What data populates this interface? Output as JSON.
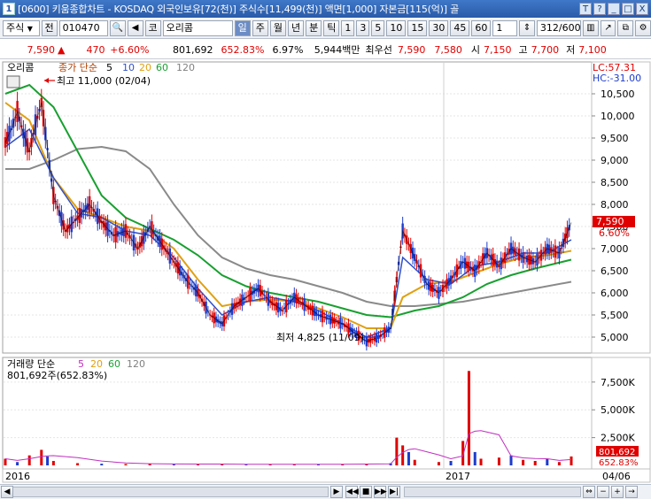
{
  "window": {
    "icon_label": "1",
    "title": "[0600] 키움종합차트 - KOSDAQ 외국인보유[72(천)] 주식수[11,499(천)] 액면[1,000] 자본금[115(억)] 골",
    "buttons": [
      "T",
      "?",
      "_",
      "□",
      "X"
    ]
  },
  "toolbar": {
    "market": "주식",
    "jeon_label": "전",
    "code": "010470",
    "name": "오리콤",
    "name_prefix": "코",
    "periods": [
      "일",
      "주",
      "월",
      "년",
      "분",
      "틱"
    ],
    "active_period": "일",
    "intervals": [
      "1",
      "3",
      "5",
      "10",
      "15",
      "30",
      "45",
      "60"
    ],
    "unit": "1",
    "page": "312/600"
  },
  "quote": {
    "price": "7,590",
    "change": "470",
    "change_pct": "+6.60%",
    "volume": "801,692",
    "volume_pct": "652.83%",
    "turnover": "6.97%",
    "amount": "5,944백만",
    "best_label": "최우선",
    "ask": "7,590",
    "bid": "7,580",
    "open_label": "시",
    "open": "7,150",
    "high_label": "고",
    "high": "7,700",
    "low_label": "저",
    "low": "7,100"
  },
  "price_panel": {
    "stock_name": "오리콤",
    "legend_prefix": "종가 단순",
    "legend": [
      {
        "label": "5",
        "color": "#000000"
      },
      {
        "label": "10",
        "color": "#3050c8"
      },
      {
        "label": "20",
        "color": "#e0a010"
      },
      {
        "label": "60",
        "color": "#18a030"
      },
      {
        "label": "120",
        "color": "#808080"
      }
    ],
    "lc": "LC:57.31",
    "hc": "HC:-31.00",
    "high_annotation": "최고 11,000 (02/04)",
    "low_annotation": "최저 4,825 (11/09)",
    "last_price_tag": "7,590",
    "last_pct_tag": "6.60%"
  },
  "volume_panel": {
    "legend_prefix": "거래량 단순",
    "legend": [
      {
        "label": "5",
        "color": "#c030c0"
      },
      {
        "label": "20",
        "color": "#e0a010"
      },
      {
        "label": "60",
        "color": "#18a030"
      },
      {
        "label": "120",
        "color": "#808080"
      }
    ],
    "value_label": "801,692주(652.83%)",
    "last_volume_tag": "801,692",
    "last_pct_tag": "652.83%"
  },
  "x_axis": {
    "labels": [
      "2016",
      "2017"
    ],
    "right_label": "04/06"
  },
  "chart_data": [
    {
      "type": "line",
      "title": "오리콤",
      "series": [
        {
          "name": "5",
          "color": "#000000"
        },
        {
          "name": "10",
          "color": "#3050c8"
        },
        {
          "name": "20",
          "color": "#e0a010"
        },
        {
          "name": "60",
          "color": "#18a030"
        },
        {
          "name": "120",
          "color": "#808080"
        }
      ],
      "y_ticks": [
        "10,500",
        "10,000",
        "9,500",
        "9,000",
        "8,500",
        "8,000",
        "7,500",
        "7,000",
        "6,500",
        "6,000",
        "5,500",
        "5,000"
      ],
      "ylim": [
        4700,
        11100
      ],
      "close_points": [
        [
          0,
          9400
        ],
        [
          1,
          9700
        ],
        [
          2,
          10100
        ],
        [
          3,
          9600
        ],
        [
          4,
          9200
        ],
        [
          5,
          9800
        ],
        [
          6,
          10300
        ],
        [
          8,
          8200
        ],
        [
          10,
          7400
        ],
        [
          12,
          7700
        ],
        [
          14,
          8000
        ],
        [
          16,
          7600
        ],
        [
          18,
          7300
        ],
        [
          20,
          7400
        ],
        [
          22,
          7000
        ],
        [
          24,
          7500
        ],
        [
          26,
          7100
        ],
        [
          28,
          6700
        ],
        [
          30,
          6300
        ],
        [
          32,
          6000
        ],
        [
          34,
          5500
        ],
        [
          36,
          5300
        ],
        [
          38,
          5700
        ],
        [
          40,
          5900
        ],
        [
          42,
          6100
        ],
        [
          44,
          5800
        ],
        [
          46,
          5600
        ],
        [
          48,
          5900
        ],
        [
          50,
          5700
        ],
        [
          52,
          5500
        ],
        [
          54,
          5400
        ],
        [
          56,
          5300
        ],
        [
          58,
          5100
        ],
        [
          60,
          4900
        ],
        [
          62,
          5000
        ],
        [
          64,
          5200
        ],
        [
          66,
          7400
        ],
        [
          68,
          6800
        ],
        [
          70,
          6200
        ],
        [
          72,
          6000
        ],
        [
          74,
          6300
        ],
        [
          76,
          6700
        ],
        [
          78,
          6500
        ],
        [
          80,
          6900
        ],
        [
          82,
          6600
        ],
        [
          84,
          7000
        ],
        [
          86,
          6800
        ],
        [
          88,
          6700
        ],
        [
          90,
          7000
        ],
        [
          92,
          6900
        ],
        [
          94,
          7590
        ]
      ],
      "ma5": [
        [
          0,
          9300
        ],
        [
          4,
          9700
        ],
        [
          8,
          8600
        ],
        [
          12,
          7800
        ],
        [
          16,
          7700
        ],
        [
          20,
          7400
        ],
        [
          24,
          7300
        ],
        [
          28,
          6800
        ],
        [
          32,
          6100
        ],
        [
          36,
          5500
        ],
        [
          40,
          5800
        ],
        [
          44,
          5900
        ],
        [
          48,
          5800
        ],
        [
          52,
          5600
        ],
        [
          56,
          5300
        ],
        [
          60,
          5000
        ],
        [
          64,
          5200
        ],
        [
          66,
          6800
        ],
        [
          70,
          6300
        ],
        [
          74,
          6200
        ],
        [
          78,
          6600
        ],
        [
          82,
          6700
        ],
        [
          86,
          6900
        ],
        [
          90,
          6900
        ],
        [
          94,
          7200
        ]
      ],
      "ma20": [
        [
          0,
          10300
        ],
        [
          4,
          9900
        ],
        [
          8,
          8600
        ],
        [
          12,
          7900
        ],
        [
          16,
          7700
        ],
        [
          20,
          7500
        ],
        [
          24,
          7400
        ],
        [
          28,
          7000
        ],
        [
          32,
          6300
        ],
        [
          36,
          5700
        ],
        [
          40,
          5800
        ],
        [
          44,
          5850
        ],
        [
          48,
          5800
        ],
        [
          52,
          5650
        ],
        [
          56,
          5450
        ],
        [
          60,
          5200
        ],
        [
          64,
          5200
        ],
        [
          66,
          5900
        ],
        [
          70,
          6200
        ],
        [
          74,
          6250
        ],
        [
          78,
          6450
        ],
        [
          82,
          6650
        ],
        [
          86,
          6800
        ],
        [
          90,
          6850
        ],
        [
          94,
          6950
        ]
      ],
      "ma60": [
        [
          0,
          10500
        ],
        [
          4,
          10700
        ],
        [
          8,
          10200
        ],
        [
          12,
          9200
        ],
        [
          16,
          8200
        ],
        [
          20,
          7700
        ],
        [
          24,
          7450
        ],
        [
          28,
          7200
        ],
        [
          32,
          6850
        ],
        [
          36,
          6400
        ],
        [
          40,
          6150
        ],
        [
          44,
          6000
        ],
        [
          48,
          5900
        ],
        [
          52,
          5800
        ],
        [
          56,
          5650
        ],
        [
          60,
          5500
        ],
        [
          64,
          5450
        ],
        [
          68,
          5600
        ],
        [
          72,
          5700
        ],
        [
          76,
          5900
        ],
        [
          80,
          6200
        ],
        [
          84,
          6400
        ],
        [
          88,
          6550
        ],
        [
          94,
          6750
        ]
      ],
      "ma120": [
        [
          0,
          8800
        ],
        [
          4,
          8800
        ],
        [
          8,
          9000
        ],
        [
          12,
          9250
        ],
        [
          16,
          9300
        ],
        [
          20,
          9200
        ],
        [
          24,
          8800
        ],
        [
          28,
          8000
        ],
        [
          32,
          7300
        ],
        [
          36,
          6800
        ],
        [
          40,
          6550
        ],
        [
          44,
          6400
        ],
        [
          48,
          6300
        ],
        [
          52,
          6150
        ],
        [
          56,
          6000
        ],
        [
          60,
          5800
        ],
        [
          64,
          5700
        ],
        [
          68,
          5700
        ],
        [
          72,
          5750
        ],
        [
          76,
          5800
        ],
        [
          80,
          5900
        ],
        [
          84,
          6000
        ],
        [
          88,
          6100
        ],
        [
          94,
          6250
        ]
      ]
    },
    {
      "type": "bar",
      "title": "거래량",
      "y_ticks": [
        "7,500K",
        "5,000K",
        "2,500K"
      ],
      "ylim": [
        0,
        9000
      ],
      "volume_k": [
        [
          0,
          600
        ],
        [
          2,
          300
        ],
        [
          4,
          900
        ],
        [
          6,
          1400
        ],
        [
          7,
          800
        ],
        [
          8,
          400
        ],
        [
          12,
          200
        ],
        [
          16,
          150
        ],
        [
          20,
          120
        ],
        [
          24,
          150
        ],
        [
          28,
          100
        ],
        [
          32,
          120
        ],
        [
          36,
          100
        ],
        [
          40,
          90
        ],
        [
          44,
          100
        ],
        [
          48,
          110
        ],
        [
          52,
          100
        ],
        [
          56,
          120
        ],
        [
          60,
          150
        ],
        [
          64,
          200
        ],
        [
          65,
          2500
        ],
        [
          66,
          1800
        ],
        [
          67,
          1200
        ],
        [
          68,
          500
        ],
        [
          72,
          300
        ],
        [
          74,
          400
        ],
        [
          76,
          2200
        ],
        [
          77,
          8500
        ],
        [
          78,
          1200
        ],
        [
          79,
          600
        ],
        [
          82,
          700
        ],
        [
          84,
          900
        ],
        [
          86,
          500
        ],
        [
          88,
          400
        ],
        [
          90,
          600
        ],
        [
          92,
          300
        ],
        [
          94,
          802
        ]
      ]
    }
  ]
}
